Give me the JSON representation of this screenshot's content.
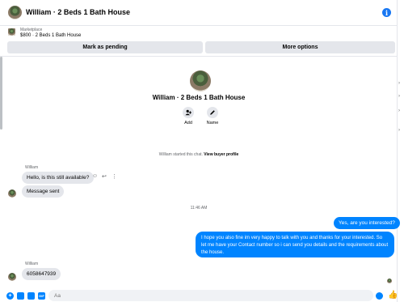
{
  "header": {
    "title": "William · 2 Beds 1 Bath House",
    "info_icon": "i"
  },
  "marketplace": {
    "label": "Marketplace",
    "item": "$800 · 2 Beds 1 Bath House",
    "mark_pending_label": "Mark as pending",
    "more_options_label": "More options"
  },
  "intro": {
    "title": "William · 2 Beds 1 Bath House",
    "actions": [
      {
        "label": "Add",
        "icon": "add-person-icon"
      },
      {
        "label": "Name",
        "icon": "pencil-icon"
      }
    ],
    "started_text": "William started this chat.",
    "view_profile_link": "View buyer profile"
  },
  "messages": [
    {
      "sender": "William",
      "text": "Hello, is this still available?",
      "direction": "incoming"
    },
    {
      "text": "Message sent",
      "direction": "incoming"
    },
    {
      "timestamp": "11:46 AM"
    },
    {
      "text": "Yes, are you interested?",
      "direction": "outgoing"
    },
    {
      "text": "I hope you also fine im very happy to talk with you and thanks for your interested. So let me have your Contact number so i can send you details and the requirements about the house.",
      "direction": "outgoing"
    },
    {
      "sender": "William",
      "text": "6058647939",
      "direction": "incoming"
    }
  ],
  "composer": {
    "placeholder": "Aa"
  },
  "colors": {
    "accent": "#0084ff",
    "bubble_in": "#e4e6eb",
    "muted": "#65676b"
  }
}
